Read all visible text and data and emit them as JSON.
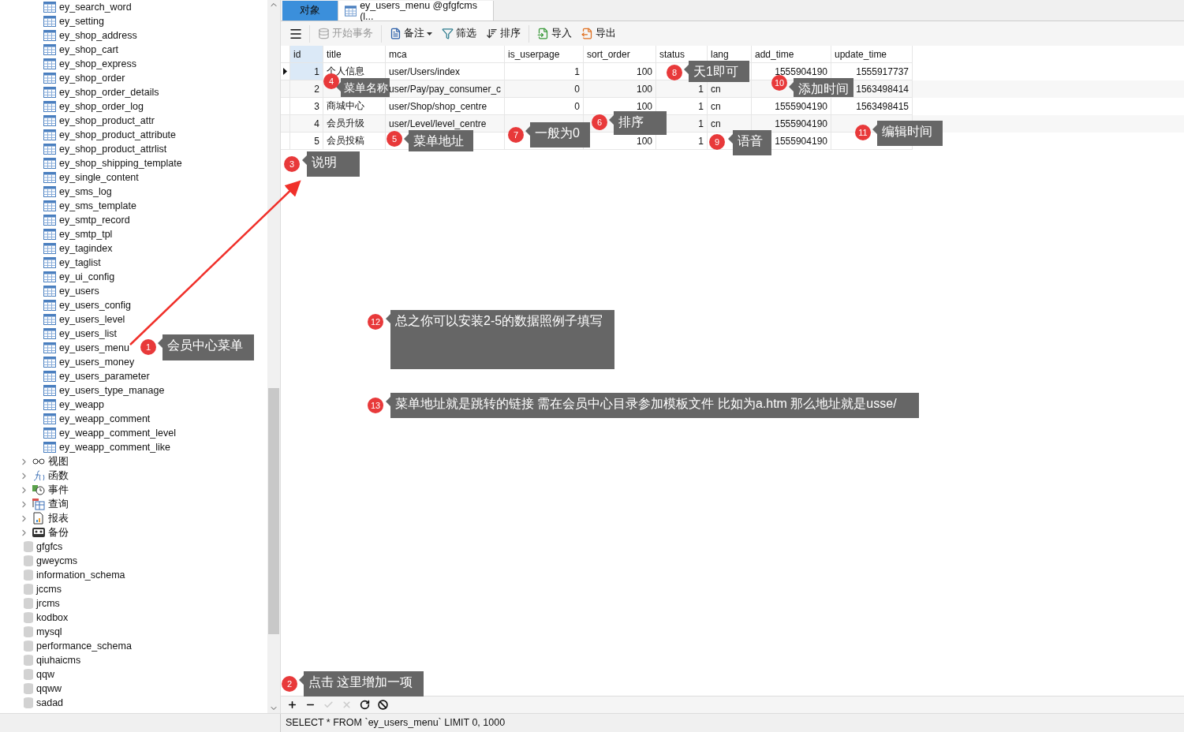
{
  "sidebar": {
    "tables": [
      "ey_search_word",
      "ey_setting",
      "ey_shop_address",
      "ey_shop_cart",
      "ey_shop_express",
      "ey_shop_order",
      "ey_shop_order_details",
      "ey_shop_order_log",
      "ey_shop_product_attr",
      "ey_shop_product_attribute",
      "ey_shop_product_attrlist",
      "ey_shop_shipping_template",
      "ey_single_content",
      "ey_sms_log",
      "ey_sms_template",
      "ey_smtp_record",
      "ey_smtp_tpl",
      "ey_tagindex",
      "ey_taglist",
      "ey_ui_config",
      "ey_users",
      "ey_users_config",
      "ey_users_level",
      "ey_users_list",
      "ey_users_menu",
      "ey_users_money",
      "ey_users_parameter",
      "ey_users_type_manage",
      "ey_weapp",
      "ey_weapp_comment",
      "ey_weapp_comment_level",
      "ey_weapp_comment_like"
    ],
    "groups": [
      {
        "kind": "view",
        "label": "视图",
        "expanded": false
      },
      {
        "kind": "function",
        "label": "函数",
        "expanded": false
      },
      {
        "kind": "event",
        "label": "事件",
        "expanded": false
      },
      {
        "kind": "query",
        "label": "查询",
        "expanded": false
      },
      {
        "kind": "report",
        "label": "报表",
        "expanded": false
      },
      {
        "kind": "backup",
        "label": "备份",
        "expanded": false
      }
    ],
    "databases": [
      "gfgfcs",
      "gweycms",
      "information_schema",
      "jccms",
      "jrcms",
      "kodbox",
      "mysql",
      "performance_schema",
      "qiuhaicms",
      "qqw",
      "qqww",
      "sadad"
    ]
  },
  "tabs": [
    {
      "kind": "objects",
      "label": "对象",
      "selected": false
    },
    {
      "kind": "table",
      "label": "ey_users_menu @gfgfcms (l...",
      "selected": true
    }
  ],
  "toolbar": [
    {
      "label": "开始事务",
      "disabled": true,
      "dropdown": false
    },
    {
      "label": "备注",
      "disabled": false,
      "dropdown": true
    },
    {
      "label": "筛选",
      "disabled": false,
      "dropdown": false
    },
    {
      "label": "排序",
      "disabled": false,
      "dropdown": false
    },
    {
      "label": "导入",
      "disabled": false,
      "dropdown": false
    },
    {
      "label": "导出",
      "disabled": false,
      "dropdown": false
    }
  ],
  "table": {
    "columns": [
      "id",
      "title",
      "mca",
      "is_userpage",
      "sort_order",
      "status",
      "lang",
      "add_time",
      "update_time"
    ],
    "rows": [
      {
        "selected": true,
        "cells": [
          "1",
          "个人信息",
          "user/Users/index",
          "1",
          "100",
          null,
          null,
          "1555904190",
          "1555917737"
        ]
      },
      {
        "selected": false,
        "cells": [
          "2",
          null,
          "user/Pay/pay_consumer_c",
          "0",
          "100",
          "1",
          "cn",
          null,
          "1563498414"
        ]
      },
      {
        "selected": false,
        "cells": [
          "3",
          "商城中心",
          "user/Shop/shop_centre",
          "0",
          "100",
          "1",
          "cn",
          "1555904190",
          "1563498415"
        ]
      },
      {
        "selected": false,
        "cells": [
          "4",
          "会员升级",
          "user/Level/level_centre",
          null,
          null,
          "1",
          "cn",
          "1555904190",
          null
        ]
      },
      {
        "selected": false,
        "cells": [
          "5",
          "会员投稿",
          null,
          null,
          "100",
          "1",
          null,
          "1555904190",
          null
        ]
      }
    ]
  },
  "bottom_toolbar": [
    {
      "kind": "add",
      "disabled": false
    },
    {
      "kind": "delete",
      "disabled": false
    },
    {
      "kind": "apply",
      "disabled": true
    },
    {
      "kind": "discard",
      "disabled": true
    },
    {
      "kind": "refresh",
      "disabled": false
    },
    {
      "kind": "stop",
      "disabled": false
    }
  ],
  "status_bar": "SELECT * FROM `ey_users_menu` LIMIT 0, 1000",
  "annotations": [
    {
      "number": "8",
      "text": "天1即可"
    },
    {
      "number": "4",
      "text": "菜单名称"
    },
    {
      "number": "10",
      "text": "添加时间"
    },
    {
      "number": "5",
      "text": "菜单地址"
    },
    {
      "number": "7",
      "text": "一般为0"
    },
    {
      "number": "6",
      "text": "排序"
    },
    {
      "number": "9",
      "text": "语音"
    },
    {
      "number": "11",
      "text": "编辑时间"
    },
    {
      "number": "3",
      "text": "说明"
    },
    {
      "number": "1",
      "text": "会员中心菜单"
    },
    {
      "number": "12",
      "text": "总之你可以安装2-5的数据照例子填写"
    },
    {
      "number": "13",
      "text": "菜单地址就是跳转的链接  需在会员中心目录参加模板文件 比如为a.htm  那么地址就是usse/"
    },
    {
      "number": "2",
      "text": "点击 这里增加一项"
    }
  ]
}
